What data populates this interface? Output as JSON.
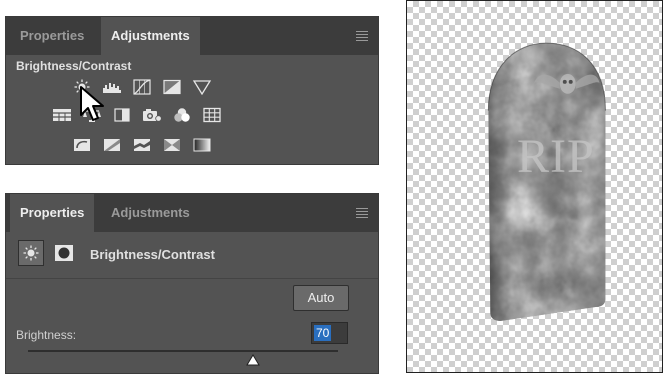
{
  "top_panel": {
    "tabs": [
      {
        "label": "Properties",
        "active": false
      },
      {
        "label": "Adjustments",
        "active": true
      }
    ],
    "section_title": "Brightness/Contrast",
    "icon_rows": [
      [
        "brightness-contrast-icon",
        "levels-icon",
        "curves-icon",
        "exposure-icon",
        "vibrance-icon"
      ],
      [
        "hue-saturation-icon",
        "color-balance-icon",
        "black-white-icon",
        "photo-filter-icon",
        "channel-mixer-icon",
        "color-lookup-icon"
      ],
      [
        "invert-icon",
        "posterize-icon",
        "threshold-icon",
        "selective-color-icon",
        "gradient-map-icon"
      ]
    ]
  },
  "bottom_panel": {
    "tabs": [
      {
        "label": "Properties",
        "active": true
      },
      {
        "label": "Adjustments",
        "active": false
      }
    ],
    "title": "Brightness/Contrast",
    "auto_label": "Auto",
    "brightness_label": "Brightness:",
    "brightness_value": "70"
  },
  "canvas": {
    "headstone_text": "RIP"
  },
  "colors": {
    "panel_bg": "#535353",
    "tabbar_bg": "#3c3c3c",
    "selection_blue": "#2a6fbf"
  }
}
